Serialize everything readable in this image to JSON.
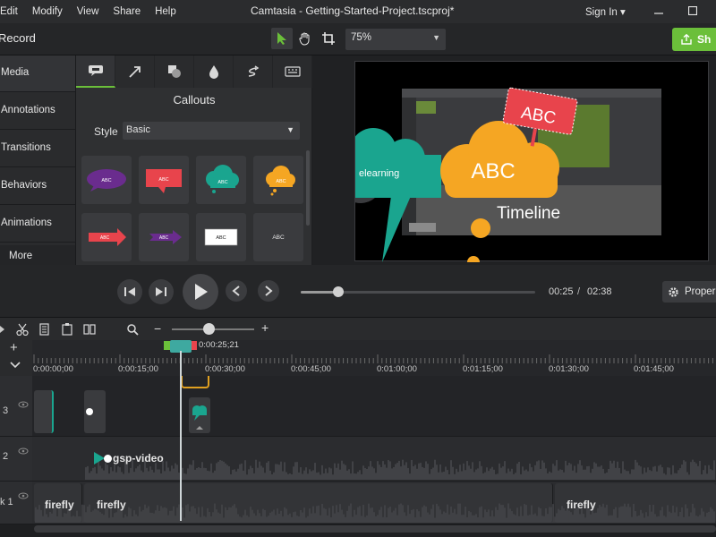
{
  "menubar": {
    "items": [
      "Edit",
      "Modify",
      "View",
      "Share",
      "Help"
    ],
    "title": "Camtasia - Getting-Started-Project.tscproj*",
    "signin": "Sign In ▾"
  },
  "toolbar": {
    "record": "Record",
    "zoom": "75%",
    "share": "Sh"
  },
  "leftnav": {
    "items": [
      "Media",
      "Annotations",
      "Transitions",
      "Behaviors",
      "Animations"
    ],
    "more": "More"
  },
  "panel": {
    "heading": "Callouts",
    "style_label": "Style",
    "style_value": "Basic",
    "callouts": [
      "ABC",
      "ABC",
      "ABC",
      "ABC",
      "ABC",
      "ABC",
      "ABC",
      "ABC"
    ]
  },
  "canvas": {
    "cloud_text": "elearning",
    "abc_big": "ABC",
    "abc_sign": "ABC",
    "timeline_text": "Timeline"
  },
  "playback": {
    "current": "00:25",
    "separator": "/",
    "total": "02:38",
    "progress_fraction": 0.16,
    "properties": "Proper"
  },
  "timeline": {
    "playhead_time": "0:00:25;21",
    "ticks": [
      "0:00:00;00",
      "0:00:15;00",
      "0:00:30;00",
      "0:00:45;00",
      "0:01:00;00",
      "0:01:15;00",
      "0:01:30;00",
      "0:01:45;00"
    ],
    "tracks": [
      {
        "num": "3"
      },
      {
        "num": "2",
        "clip": "gsp-video"
      },
      {
        "num": "k 1",
        "clips": [
          "firefly",
          "firefly",
          "firefly"
        ]
      }
    ],
    "plus": "+",
    "minus": "−"
  },
  "colors": {
    "accent_green": "#6bbf3a",
    "teal": "#1aa58f",
    "orange": "#f5a623",
    "red": "#e8444c"
  }
}
